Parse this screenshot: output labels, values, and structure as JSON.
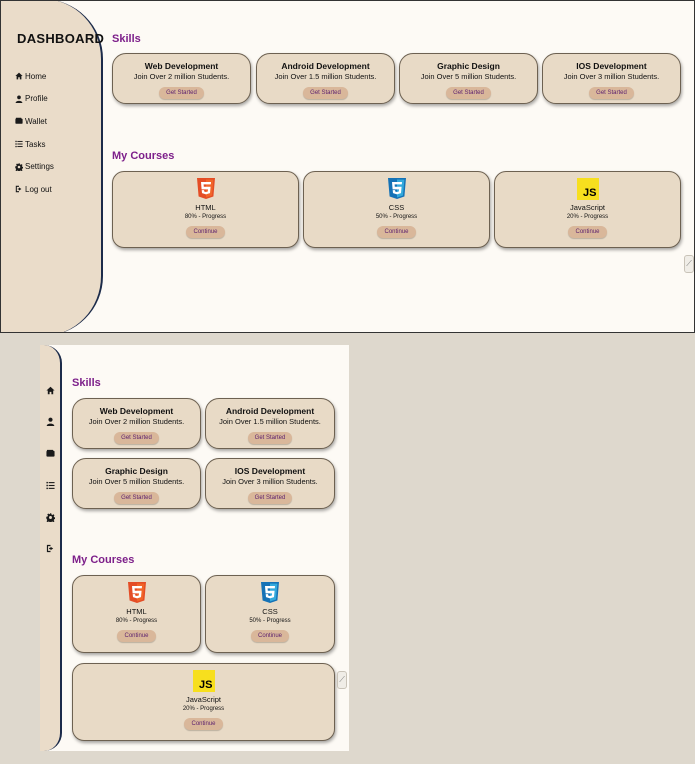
{
  "desktop": {
    "brand": "DASHBOARD",
    "nav": [
      {
        "label": "Home",
        "icon": "home-icon"
      },
      {
        "label": "Profile",
        "icon": "user-icon"
      },
      {
        "label": "Wallet",
        "icon": "wallet-icon"
      },
      {
        "label": "Tasks",
        "icon": "tasks-icon"
      },
      {
        "label": "Settings",
        "icon": "gear-icon"
      },
      {
        "label": "Log out",
        "icon": "logout-icon"
      }
    ]
  },
  "skills_title": "Skills",
  "skills": [
    {
      "title": "Web Development",
      "subtitle": "Join Over 2 million Students.",
      "button": "Get Started"
    },
    {
      "title": "Android Development",
      "subtitle": "Join Over 1.5 million Students.",
      "button": "Get Started"
    },
    {
      "title": "Graphic Design",
      "subtitle": "Join Over 5 million Students.",
      "button": "Get Started"
    },
    {
      "title": "IOS Development",
      "subtitle": "Join Over 3 million Students.",
      "button": "Get Started"
    }
  ],
  "courses_title": "My Courses",
  "courses": [
    {
      "name": "HTML",
      "progress": "80% - Progress",
      "button": "Continue",
      "logo": "html5-icon"
    },
    {
      "name": "CSS",
      "progress": "50% - Progress",
      "button": "Continue",
      "logo": "css3-icon"
    },
    {
      "name": "JavaScript",
      "progress": "20% - Progress",
      "button": "Continue",
      "logo": "js-icon",
      "logo_text": "JS"
    }
  ],
  "colors": {
    "accent": "#7d1f8a",
    "sidebar": "#eadcc9",
    "card": "#e8dac6",
    "button": "#d9b79a",
    "border": "#1c2b4a"
  }
}
